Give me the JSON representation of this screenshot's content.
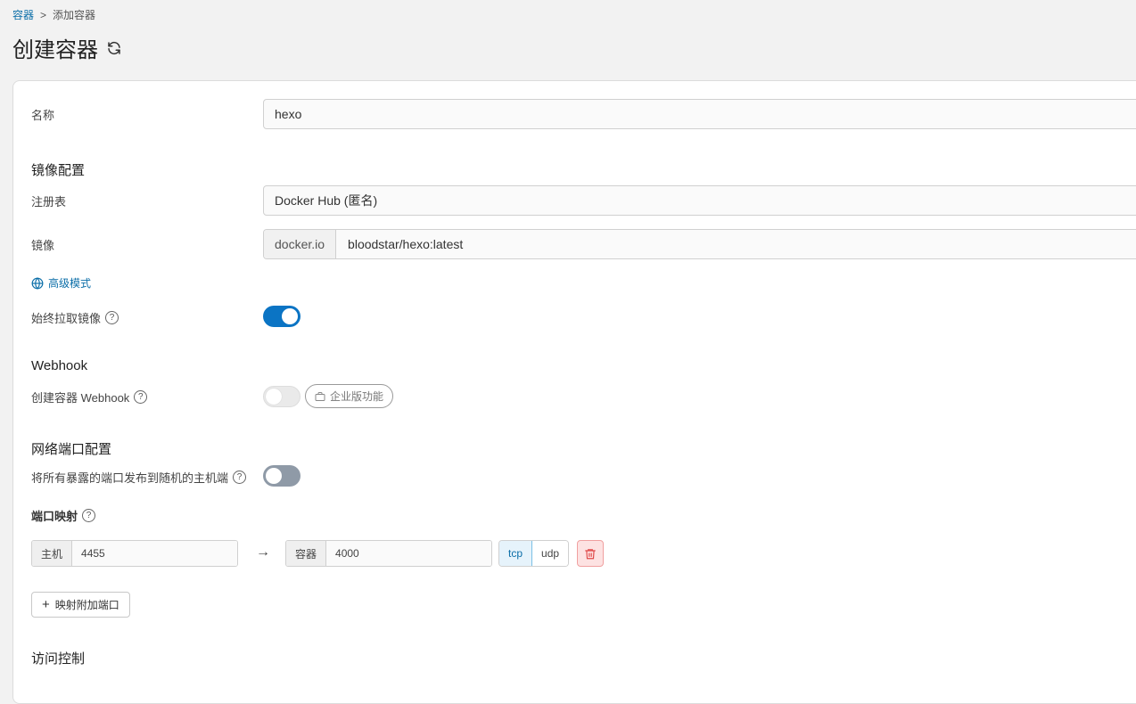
{
  "breadcrumb": {
    "parent": "容器",
    "separator": ">",
    "current": "添加容器"
  },
  "page": {
    "title": "创建容器"
  },
  "form": {
    "name": {
      "label": "名称",
      "value": "hexo"
    },
    "image_section": {
      "title": "镜像配置",
      "registry_label": "注册表",
      "registry_value": "Docker Hub (匿名)",
      "image_label": "镜像",
      "image_prefix": "docker.io",
      "image_value": "bloodstar/hexo:latest",
      "advanced_mode": "高级模式",
      "always_pull_label": "始终拉取镜像",
      "always_pull": true
    },
    "webhook_section": {
      "title": "Webhook",
      "create_label": "创建容器 Webhook",
      "enabled": false,
      "enterprise_badge": "企业版功能"
    },
    "network_section": {
      "title": "网络端口配置",
      "publish_all_label": "将所有暴露的端口发布到随机的主机端",
      "publish_all": false,
      "port_mapping_label": "端口映射",
      "mappings": [
        {
          "host_label": "主机",
          "host_port": "4455",
          "container_label": "容器",
          "container_port": "4000",
          "protocol_tcp": "tcp",
          "protocol_udp": "udp",
          "selected": "tcp"
        }
      ],
      "add_mapping": "映射附加端口"
    },
    "access_section": {
      "title": "访问控制"
    }
  },
  "colors": {
    "accent": "#0b74c4",
    "link": "#0b6ea8",
    "danger": "#e04848"
  }
}
